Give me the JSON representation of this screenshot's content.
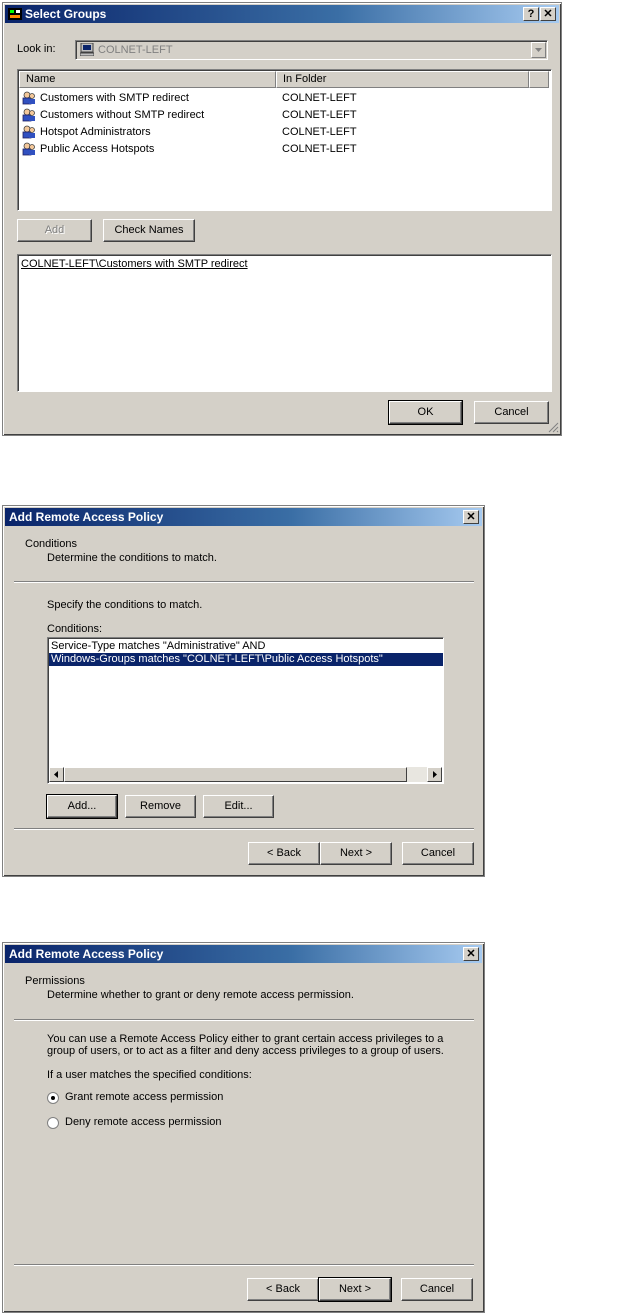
{
  "select_groups": {
    "title": "Select Groups",
    "help_label": "?",
    "close_label": "✕",
    "look_in_label": "Look in:",
    "look_in_value": "COLNET-LEFT",
    "columns": [
      "Name",
      "In Folder"
    ],
    "rows": [
      {
        "name": "Customers with SMTP redirect",
        "folder": "COLNET-LEFT"
      },
      {
        "name": "Customers without SMTP redirect",
        "folder": "COLNET-LEFT"
      },
      {
        "name": "Hotspot Administrators",
        "folder": "COLNET-LEFT"
      },
      {
        "name": "Public Access Hotspots",
        "folder": "COLNET-LEFT"
      }
    ],
    "add_label": "Add",
    "check_names_label": "Check Names",
    "selected_text": "COLNET-LEFT\\Customers with SMTP redirect",
    "ok_label": "OK",
    "cancel_label": "Cancel"
  },
  "conditions_dialog": {
    "title": "Add Remote Access Policy",
    "close_label": "✕",
    "heading": "Conditions",
    "subheading": "Determine the conditions to match.",
    "instruction": "Specify the conditions to match.",
    "list_label": "Conditions:",
    "items": [
      "Service-Type matches \"Administrative\" AND",
      "Windows-Groups matches \"COLNET-LEFT\\Public Access Hotspots\""
    ],
    "add_label": "Add...",
    "remove_label": "Remove",
    "edit_label": "Edit...",
    "back_label": "< Back",
    "next_label": "Next >",
    "cancel_label": "Cancel"
  },
  "permissions_dialog": {
    "title": "Add Remote Access Policy",
    "close_label": "✕",
    "heading": "Permissions",
    "subheading": "Determine whether to grant or deny remote access permission.",
    "description_line1": "You can use a Remote Access Policy either to grant certain access privileges to a",
    "description_line2": "group of users, or to act as a filter and deny access privileges to a group of users.",
    "question": "If a user matches the specified conditions:",
    "grant_label": "Grant remote access permission",
    "deny_label": "Deny remote access permission",
    "selected_option": "grant",
    "back_label": "< Back",
    "next_label": "Next >",
    "cancel_label": "Cancel"
  },
  "colors": {
    "dialog_face": "#d4d0c8",
    "title_active": "#0a246a",
    "selection": "#0a246a"
  }
}
